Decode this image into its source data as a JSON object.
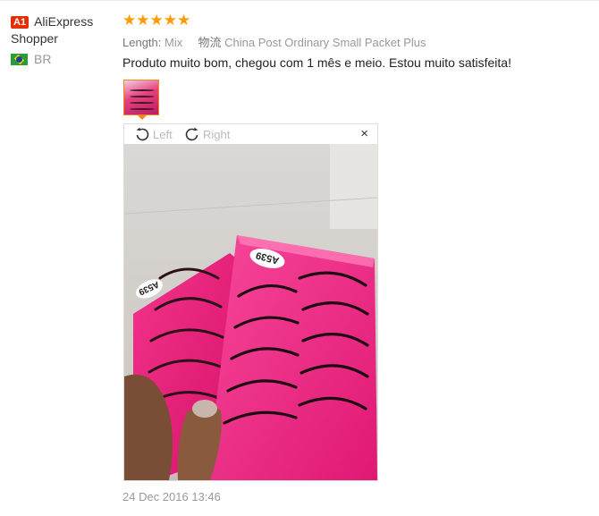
{
  "user": {
    "badge": "A1",
    "name": "AliExpress Shopper",
    "country": "BR"
  },
  "review": {
    "rating_stars": "★★★★★",
    "rating": 5,
    "length_label": "Length:",
    "length_value": "Mix",
    "logistics_label": "物流",
    "logistics_value": "China Post Ordinary Small Packet Plus",
    "text": "Produto muito bom, chegou com 1 mês e meio. Estou muito satisfeita!",
    "date": "24 Dec 2016 13:46"
  },
  "viewer": {
    "left_label": "Left",
    "right_label": "Right",
    "close_glyph": "×",
    "package_code_1": "A539",
    "package_code_2": "A539"
  },
  "colors": {
    "star": "#ff9b00",
    "badge": "#e62e04",
    "thumb_border": "#f0891a",
    "pink": "#ec1f7a"
  }
}
